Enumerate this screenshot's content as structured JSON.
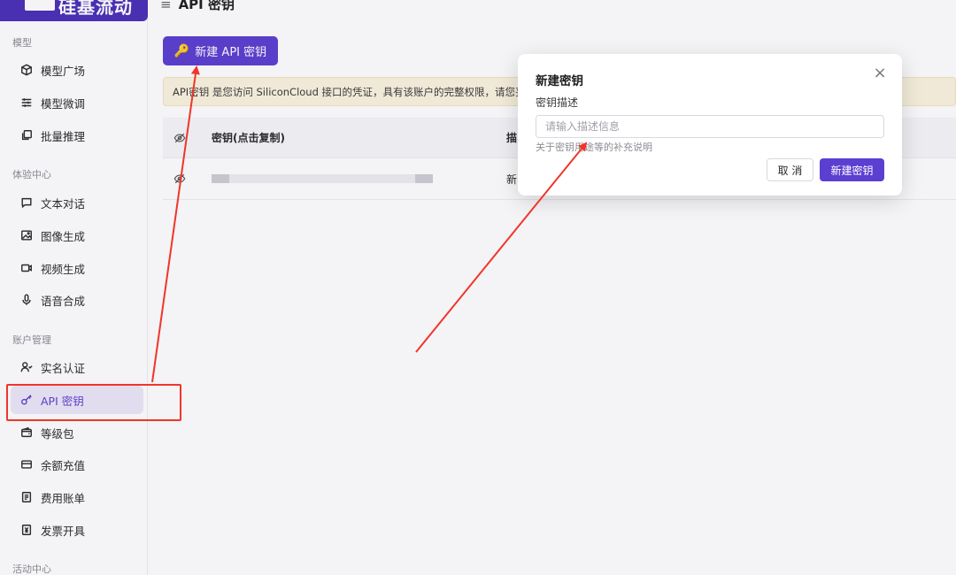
{
  "app": {
    "logo_text": "硅基流动"
  },
  "sidebar": {
    "groups": [
      {
        "label": "模型"
      },
      {
        "label": "体验中心"
      },
      {
        "label": "账户管理"
      },
      {
        "label": "活动中心"
      }
    ],
    "items": [
      {
        "label": "模型广场",
        "icon": "cube-icon"
      },
      {
        "label": "模型微调",
        "icon": "sliders-icon"
      },
      {
        "label": "批量推理",
        "icon": "batch-icon"
      },
      {
        "label": "文本对话",
        "icon": "chat-icon"
      },
      {
        "label": "图像生成",
        "icon": "image-icon"
      },
      {
        "label": "视频生成",
        "icon": "video-icon"
      },
      {
        "label": "语音合成",
        "icon": "mic-icon"
      },
      {
        "label": "实名认证",
        "icon": "user-check-icon"
      },
      {
        "label": "API 密钥",
        "icon": "key-icon"
      },
      {
        "label": "等级包",
        "icon": "wallet-icon"
      },
      {
        "label": "余额充值",
        "icon": "card-icon"
      },
      {
        "label": "费用账单",
        "icon": "bill-icon"
      },
      {
        "label": "发票开具",
        "icon": "invoice-icon"
      }
    ],
    "active_item": "API 密钥"
  },
  "main": {
    "page_title": "API 密钥",
    "new_key_button": "新建 API 密钥",
    "notice": "API密钥 是您访问 SiliconCloud 接口的凭证，具有该账户的完整权限，请您妥",
    "table": {
      "headers": [
        "密钥(点击复制)",
        "描"
      ],
      "rows": [
        {
          "description": "新"
        }
      ]
    }
  },
  "modal": {
    "title": "新建密钥",
    "field_label": "密钥描述",
    "input_placeholder": "请输入描述信息",
    "input_value": "",
    "help_text": "关于密钥用途等的补充说明",
    "cancel_label": "取 消",
    "submit_label": "新建密钥",
    "close_glyph": "×"
  },
  "colors": {
    "brand": "#5b3fd1",
    "annotation": "#f0352a",
    "notice_bg": "#fbf5e0"
  }
}
